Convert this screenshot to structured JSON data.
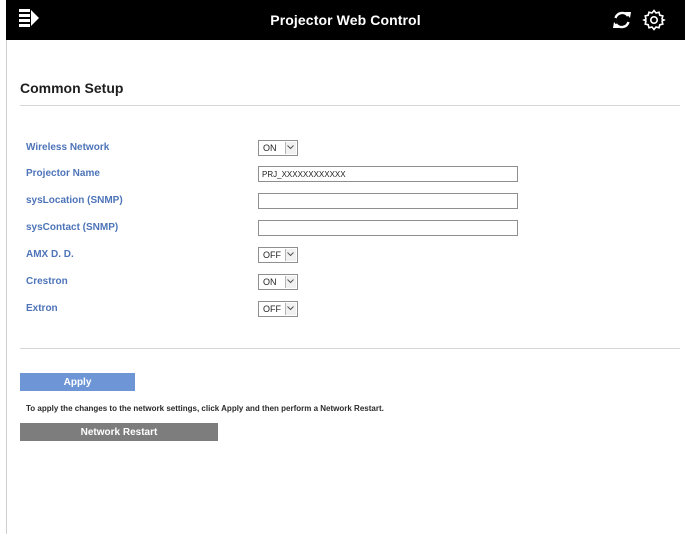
{
  "header": {
    "title": "Projector Web Control",
    "menu_icon": "menu-icon",
    "refresh_icon": "refresh-icon",
    "settings_icon": "gear-icon"
  },
  "section": {
    "title": "Common Setup"
  },
  "form": {
    "wireless_network": {
      "label": "Wireless Network",
      "value": "ON"
    },
    "projector_name": {
      "label": "Projector Name",
      "value": "PRJ_XXXXXXXXXXXX"
    },
    "sys_location": {
      "label": "sysLocation (SNMP)",
      "value": ""
    },
    "sys_contact": {
      "label": "sysContact (SNMP)",
      "value": ""
    },
    "amx_dd": {
      "label": "AMX D. D.",
      "value": "OFF"
    },
    "crestron": {
      "label": "Crestron",
      "value": "ON"
    },
    "extron": {
      "label": "Extron",
      "value": "OFF"
    }
  },
  "actions": {
    "apply_label": "Apply",
    "hint": "To apply the changes to the network settings, click Apply and then perform a Network Restart.",
    "restart_label": "Network Restart"
  },
  "colors": {
    "header_bg": "#000000",
    "label_blue": "#4d74b8",
    "apply_bg": "#6e96d6",
    "restart_bg": "#7d7d7d"
  }
}
